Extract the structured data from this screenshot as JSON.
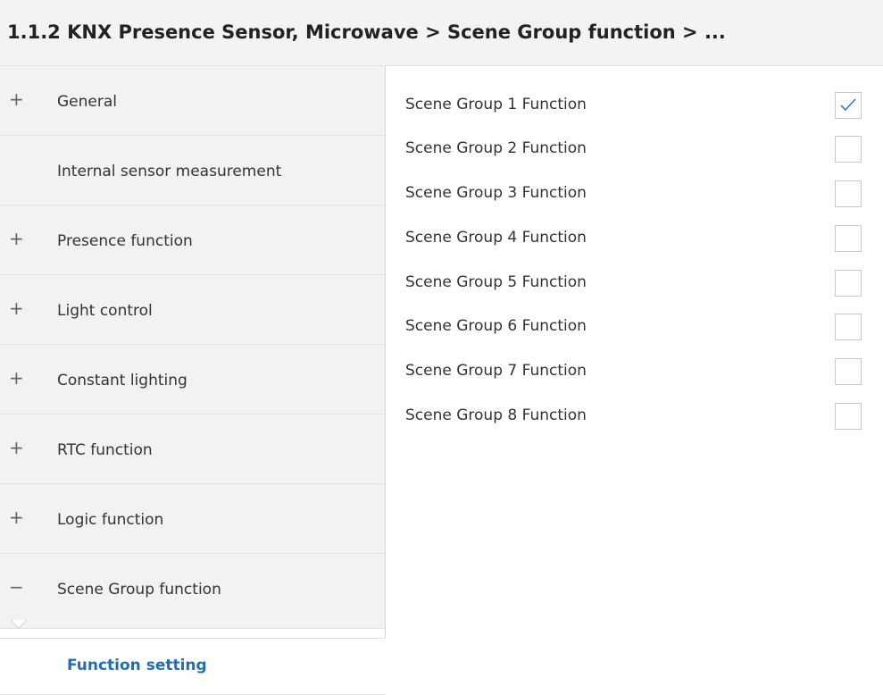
{
  "header": {
    "title": "1.1.2 KNX Presence Sensor, Microwave > Scene Group function > ..."
  },
  "sidebar": {
    "items": [
      {
        "sign": "+",
        "label": "General"
      },
      {
        "sign": "",
        "label": "Internal sensor measurement"
      },
      {
        "sign": "+",
        "label": "Presence function"
      },
      {
        "sign": "+",
        "label": "Light control"
      },
      {
        "sign": "+",
        "label": "Constant lighting"
      },
      {
        "sign": "+",
        "label": "RTC function"
      },
      {
        "sign": "+",
        "label": "Logic function"
      },
      {
        "sign": "−",
        "label": "Scene Group function"
      }
    ],
    "sub_item": {
      "label": "Function setting"
    }
  },
  "main": {
    "rows": [
      {
        "label": "Scene Group 1 Function",
        "checked": true
      },
      {
        "label": "Scene Group 2 Function",
        "checked": false
      },
      {
        "label": "Scene Group 3 Function",
        "checked": false
      },
      {
        "label": "Scene Group 4 Function",
        "checked": false
      },
      {
        "label": "Scene Group 5 Function",
        "checked": false
      },
      {
        "label": "Scene Group 6 Function",
        "checked": false
      },
      {
        "label": "Scene Group 7 Function",
        "checked": false
      },
      {
        "label": "Scene Group 8 Function",
        "checked": false
      }
    ]
  },
  "colors": {
    "accent": "#1f6fb6",
    "check": "#3a78c3",
    "sidebar_bg": "#f2f2f2"
  },
  "icons": {
    "expand": "plus-icon",
    "collapse": "minus-icon",
    "check": "checkmark-icon"
  }
}
